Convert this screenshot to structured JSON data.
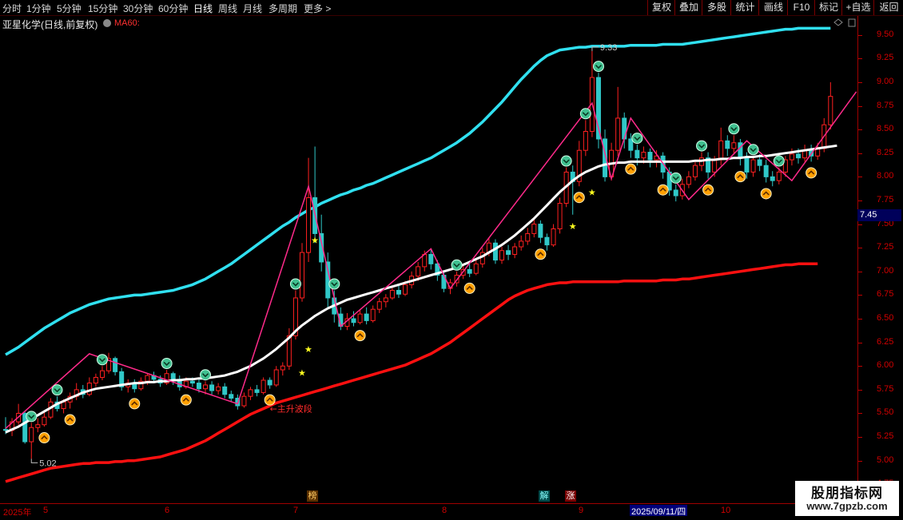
{
  "toolbar": {
    "periods": [
      "分时",
      "1分钟",
      "5分钟",
      "15分钟",
      "30分钟",
      "60分钟",
      "日线",
      "周线",
      "月线",
      "多周期",
      "更多 >"
    ],
    "active_period": "日线",
    "right_buttons": [
      "复权",
      "叠加",
      "多股",
      "统计",
      "画线",
      "F10",
      "标记",
      "+自选",
      "返回"
    ]
  },
  "header": {
    "stock_name": "亚星化学(日线,前复权)",
    "ma_label": "MA60:"
  },
  "price_axis": {
    "ticks": [
      "9.50",
      "9.25",
      "9.00",
      "8.75",
      "8.50",
      "8.25",
      "8.00",
      "7.75",
      "7.50",
      "7.25",
      "7.00",
      "6.75",
      "6.50",
      "6.25",
      "6.00",
      "5.75",
      "5.50",
      "5.25",
      "5.00",
      "4.75"
    ],
    "current_price": "7.45"
  },
  "date_axis": {
    "labels": [
      "2025年",
      "5",
      "6",
      "7",
      "8",
      "9",
      "10"
    ],
    "highlight": "2025/09/11/四"
  },
  "flags": [
    {
      "text": "榜",
      "color": "#ffcc66",
      "bg": "#5a3000"
    },
    {
      "text": "解",
      "color": "#88ffff",
      "bg": "#004a4a"
    },
    {
      "text": "涨",
      "color": "#ffffff",
      "bg": "#7a0000"
    }
  ],
  "annotations": {
    "high_label": "9.33",
    "low_label": "5.02",
    "wave_label": "←主升波段"
  },
  "colors": {
    "up": "#ff2020",
    "down": "#30c8c8",
    "upper_band": "#30e0f0",
    "lower_band": "#ff1010",
    "ma60": "#ffffff",
    "zigzag": "#ff2a8a",
    "sell_signal": "#40c090",
    "buy_signal": "#ffa000",
    "star": "#ffff20"
  },
  "watermark": {
    "title": "股朋指标网",
    "url": "www.7gpzb.com"
  },
  "chart_data": {
    "type": "candlestick",
    "ylim": [
      4.55,
      9.7
    ],
    "candles": [
      [
        5.33,
        5.32,
        5.46,
        5.28
      ],
      [
        5.32,
        5.41,
        5.45,
        5.26
      ],
      [
        5.41,
        5.5,
        5.6,
        5.38
      ],
      [
        5.5,
        5.2,
        5.52,
        5.18
      ],
      [
        5.2,
        5.35,
        5.4,
        5.02
      ],
      [
        5.35,
        5.38,
        5.45,
        5.3
      ],
      [
        5.38,
        5.46,
        5.52,
        5.36
      ],
      [
        5.46,
        5.62,
        5.66,
        5.44
      ],
      [
        5.62,
        5.55,
        5.68,
        5.52
      ],
      [
        5.55,
        5.62,
        5.65,
        5.5
      ],
      [
        5.62,
        5.68,
        5.72,
        5.55
      ],
      [
        5.68,
        5.75,
        5.82,
        5.64
      ],
      [
        5.75,
        5.7,
        5.8,
        5.66
      ],
      [
        5.7,
        5.82,
        5.88,
        5.68
      ],
      [
        5.82,
        5.88,
        5.92,
        5.78
      ],
      [
        5.88,
        5.95,
        6.0,
        5.85
      ],
      [
        5.95,
        6.08,
        6.14,
        5.92
      ],
      [
        6.08,
        5.94,
        6.1,
        5.9
      ],
      [
        5.94,
        5.78,
        5.98,
        5.74
      ],
      [
        5.78,
        5.82,
        5.86,
        5.72
      ],
      [
        5.82,
        5.76,
        5.86,
        5.72
      ],
      [
        5.76,
        5.84,
        5.88,
        5.74
      ],
      [
        5.84,
        5.9,
        5.92,
        5.8
      ],
      [
        5.9,
        5.86,
        5.94,
        5.82
      ],
      [
        5.86,
        5.82,
        5.9,
        5.78
      ],
      [
        5.82,
        5.92,
        5.96,
        5.8
      ],
      [
        5.92,
        5.86,
        5.94,
        5.8
      ],
      [
        5.86,
        5.78,
        5.9,
        5.74
      ],
      [
        5.78,
        5.84,
        5.88,
        5.76
      ],
      [
        5.84,
        5.82,
        5.88,
        5.78
      ],
      [
        5.82,
        5.76,
        5.86,
        5.72
      ],
      [
        5.76,
        5.8,
        5.84,
        5.7
      ],
      [
        5.8,
        5.74,
        5.84,
        5.7
      ],
      [
        5.74,
        5.78,
        5.82,
        5.7
      ],
      [
        5.78,
        5.7,
        5.82,
        5.66
      ],
      [
        5.7,
        5.66,
        5.74,
        5.62
      ],
      [
        5.66,
        5.58,
        5.7,
        5.54
      ],
      [
        5.58,
        5.68,
        5.72,
        5.56
      ],
      [
        5.68,
        5.75,
        5.78,
        5.64
      ],
      [
        5.75,
        5.72,
        5.8,
        5.68
      ],
      [
        5.72,
        5.85,
        5.88,
        5.7
      ],
      [
        5.85,
        5.8,
        5.88,
        5.76
      ],
      [
        5.8,
        5.96,
        6.0,
        5.78
      ],
      [
        5.96,
        6.0,
        6.04,
        5.9
      ],
      [
        6.0,
        6.32,
        6.4,
        5.96
      ],
      [
        6.32,
        6.72,
        6.8,
        6.28
      ],
      [
        6.72,
        7.2,
        7.3,
        6.68
      ],
      [
        7.2,
        7.78,
        8.2,
        7.1
      ],
      [
        7.78,
        7.4,
        8.32,
        7.3
      ],
      [
        7.4,
        7.1,
        7.6,
        7.0
      ],
      [
        7.1,
        6.72,
        7.2,
        6.6
      ],
      [
        6.72,
        6.55,
        6.8,
        6.46
      ],
      [
        6.55,
        6.42,
        6.62,
        6.38
      ],
      [
        6.42,
        6.5,
        6.56,
        6.38
      ],
      [
        6.5,
        6.46,
        6.58,
        6.42
      ],
      [
        6.46,
        6.55,
        6.6,
        6.44
      ],
      [
        6.55,
        6.48,
        6.62,
        6.44
      ],
      [
        6.48,
        6.6,
        6.64,
        6.46
      ],
      [
        6.6,
        6.68,
        6.72,
        6.56
      ],
      [
        6.68,
        6.72,
        6.76,
        6.62
      ],
      [
        6.72,
        6.8,
        6.84,
        6.7
      ],
      [
        6.8,
        6.76,
        6.86,
        6.72
      ],
      [
        6.76,
        6.86,
        6.9,
        6.74
      ],
      [
        6.86,
        6.95,
        7.0,
        6.82
      ],
      [
        6.95,
        7.05,
        7.1,
        6.9
      ],
      [
        7.05,
        7.18,
        7.22,
        7.0
      ],
      [
        7.18,
        7.08,
        7.24,
        7.02
      ],
      [
        7.08,
        6.96,
        7.12,
        6.9
      ],
      [
        6.96,
        6.82,
        7.0,
        6.78
      ],
      [
        6.82,
        6.88,
        6.92,
        6.76
      ],
      [
        6.88,
        6.96,
        7.0,
        6.84
      ],
      [
        6.96,
        7.02,
        7.06,
        6.92
      ],
      [
        7.02,
        6.98,
        7.08,
        6.94
      ],
      [
        6.98,
        7.08,
        7.12,
        6.96
      ],
      [
        7.08,
        7.2,
        7.25,
        7.04
      ],
      [
        7.2,
        7.3,
        7.36,
        7.16
      ],
      [
        7.3,
        7.12,
        7.34,
        7.08
      ],
      [
        7.12,
        7.22,
        7.26,
        7.08
      ],
      [
        7.22,
        7.18,
        7.28,
        7.12
      ],
      [
        7.18,
        7.26,
        7.3,
        7.14
      ],
      [
        7.26,
        7.32,
        7.38,
        7.22
      ],
      [
        7.32,
        7.4,
        7.46,
        7.28
      ],
      [
        7.4,
        7.5,
        7.56,
        7.36
      ],
      [
        7.5,
        7.36,
        7.54,
        7.3
      ],
      [
        7.36,
        7.28,
        7.4,
        7.22
      ],
      [
        7.28,
        7.45,
        7.5,
        7.26
      ],
      [
        7.45,
        7.72,
        7.78,
        7.4
      ],
      [
        7.72,
        8.05,
        8.1,
        7.68
      ],
      [
        8.05,
        7.95,
        8.12,
        7.6
      ],
      [
        7.95,
        8.28,
        8.38,
        7.9
      ],
      [
        8.28,
        8.48,
        8.6,
        8.22
      ],
      [
        8.48,
        9.05,
        9.33,
        8.42
      ],
      [
        9.05,
        8.4,
        9.1,
        8.3
      ],
      [
        8.4,
        8.0,
        8.5,
        7.95
      ],
      [
        8.0,
        8.28,
        8.36,
        7.96
      ],
      [
        8.28,
        8.62,
        8.95,
        8.22
      ],
      [
        8.62,
        8.4,
        8.68,
        8.3
      ],
      [
        8.4,
        8.28,
        8.46,
        8.2
      ],
      [
        8.28,
        8.2,
        8.34,
        8.12
      ],
      [
        8.2,
        8.26,
        8.32,
        8.14
      ],
      [
        8.26,
        8.18,
        8.3,
        8.1
      ],
      [
        8.18,
        8.22,
        8.28,
        8.1
      ],
      [
        8.22,
        8.05,
        8.26,
        7.98
      ],
      [
        8.05,
        7.86,
        8.1,
        7.8
      ],
      [
        7.86,
        7.8,
        7.92,
        7.74
      ],
      [
        7.8,
        7.92,
        7.98,
        7.76
      ],
      [
        7.92,
        8.0,
        8.06,
        7.88
      ],
      [
        8.0,
        8.12,
        8.18,
        7.96
      ],
      [
        8.12,
        8.2,
        8.26,
        8.06
      ],
      [
        8.2,
        8.05,
        8.26,
        7.98
      ],
      [
        8.05,
        8.18,
        8.22,
        8.0
      ],
      [
        8.18,
        8.38,
        8.52,
        8.12
      ],
      [
        8.38,
        8.3,
        8.44,
        8.22
      ],
      [
        8.3,
        8.36,
        8.44,
        8.24
      ],
      [
        8.36,
        8.2,
        8.4,
        8.12
      ],
      [
        8.2,
        8.05,
        8.26,
        7.98
      ],
      [
        8.05,
        8.18,
        8.22,
        8.0
      ],
      [
        8.18,
        8.12,
        8.24,
        8.06
      ],
      [
        8.12,
        8.0,
        8.18,
        7.94
      ],
      [
        8.0,
        7.96,
        8.06,
        7.9
      ],
      [
        7.96,
        8.05,
        8.1,
        7.92
      ],
      [
        8.05,
        8.18,
        8.22,
        8.0
      ],
      [
        8.18,
        8.24,
        8.3,
        8.12
      ],
      [
        8.24,
        8.2,
        8.3,
        8.14
      ],
      [
        8.2,
        8.28,
        8.34,
        8.16
      ],
      [
        8.28,
        8.22,
        8.34,
        8.16
      ],
      [
        8.22,
        8.3,
        8.36,
        8.18
      ],
      [
        8.3,
        8.55,
        8.62,
        8.26
      ],
      [
        8.55,
        8.85,
        9.0,
        8.5
      ]
    ],
    "zigzag": [
      [
        0,
        5.34
      ],
      [
        13,
        6.13
      ],
      [
        36,
        5.6
      ],
      [
        47,
        7.9
      ],
      [
        52,
        6.42
      ],
      [
        66,
        7.24
      ],
      [
        69,
        6.82
      ],
      [
        91,
        8.78
      ],
      [
        94,
        7.98
      ],
      [
        97,
        8.62
      ],
      [
        106,
        7.76
      ],
      [
        115,
        8.38
      ],
      [
        122,
        7.96
      ],
      [
        132,
        8.9
      ]
    ],
    "sell_signals": [
      4,
      8,
      15,
      25,
      31,
      45,
      51,
      70,
      87,
      90,
      92,
      98,
      104,
      108,
      113,
      116,
      120
    ],
    "buy_signals": [
      6,
      10,
      20,
      28,
      41,
      55,
      72,
      83,
      89,
      97,
      102,
      109,
      114,
      118,
      125
    ],
    "stars": [
      [
        48,
        7.33
      ],
      [
        47,
        6.18
      ],
      [
        46,
        5.93
      ],
      [
        88,
        7.48
      ],
      [
        91,
        7.84
      ]
    ],
    "ma60": [
      5.3,
      5.33,
      5.36,
      5.4,
      5.44,
      5.48,
      5.52,
      5.56,
      5.6,
      5.63,
      5.66,
      5.69,
      5.72,
      5.74,
      5.76,
      5.77,
      5.78,
      5.79,
      5.8,
      5.81,
      5.82,
      5.82,
      5.83,
      5.83,
      5.84,
      5.84,
      5.85,
      5.85,
      5.86,
      5.86,
      5.87,
      5.87,
      5.88,
      5.89,
      5.9,
      5.92,
      5.94,
      5.97,
      6.0,
      6.04,
      6.08,
      6.13,
      6.18,
      6.24,
      6.3,
      6.37,
      6.43,
      6.48,
      6.53,
      6.57,
      6.61,
      6.64,
      6.67,
      6.7,
      6.72,
      6.74,
      6.76,
      6.78,
      6.8,
      6.82,
      6.84,
      6.86,
      6.88,
      6.9,
      6.92,
      6.94,
      6.96,
      6.98,
      7.0,
      7.02,
      7.04,
      7.07,
      7.1,
      7.13,
      7.16,
      7.2,
      7.24,
      7.28,
      7.33,
      7.38,
      7.44,
      7.5,
      7.56,
      7.63,
      7.7,
      7.77,
      7.84,
      7.9,
      7.96,
      8.01,
      8.05,
      8.08,
      8.11,
      8.13,
      8.14,
      8.15,
      8.15,
      8.16,
      8.16,
      8.16,
      8.16,
      8.16,
      8.16,
      8.16,
      8.16,
      8.16,
      8.16,
      8.17,
      8.17,
      8.18,
      8.18,
      8.19,
      8.19,
      8.2,
      8.2,
      8.21,
      8.21,
      8.22,
      8.22,
      8.23,
      8.24,
      8.25,
      8.26,
      8.27,
      8.28,
      8.29,
      8.3,
      8.31,
      8.32,
      8.33
    ],
    "upper_band": [
      6.12,
      6.16,
      6.2,
      6.25,
      6.3,
      6.35,
      6.4,
      6.44,
      6.48,
      6.52,
      6.56,
      6.59,
      6.62,
      6.65,
      6.67,
      6.69,
      6.71,
      6.72,
      6.73,
      6.74,
      6.75,
      6.75,
      6.76,
      6.77,
      6.78,
      6.79,
      6.8,
      6.82,
      6.84,
      6.86,
      6.89,
      6.92,
      6.96,
      7.0,
      7.04,
      7.08,
      7.13,
      7.18,
      7.23,
      7.28,
      7.33,
      7.38,
      7.43,
      7.48,
      7.52,
      7.57,
      7.61,
      7.65,
      7.68,
      7.72,
      7.75,
      7.78,
      7.81,
      7.83,
      7.86,
      7.88,
      7.91,
      7.93,
      7.96,
      7.99,
      8.02,
      8.05,
      8.08,
      8.11,
      8.14,
      8.17,
      8.2,
      8.24,
      8.28,
      8.32,
      8.36,
      8.41,
      8.46,
      8.52,
      8.58,
      8.65,
      8.72,
      8.79,
      8.87,
      8.95,
      9.03,
      9.1,
      9.17,
      9.23,
      9.28,
      9.31,
      9.34,
      9.35,
      9.36,
      9.37,
      9.37,
      9.38,
      9.38,
      9.38,
      9.38,
      9.38,
      9.38,
      9.39,
      9.39,
      9.39,
      9.39,
      9.39,
      9.4,
      9.4,
      9.4,
      9.4,
      9.41,
      9.42,
      9.43,
      9.44,
      9.45,
      9.46,
      9.47,
      9.48,
      9.49,
      9.5,
      9.51,
      9.52,
      9.53,
      9.54,
      9.55,
      9.56,
      9.56,
      9.57,
      9.57,
      9.57,
      9.57,
      9.57,
      9.57
    ],
    "lower_band": [
      4.78,
      4.8,
      4.82,
      4.84,
      4.86,
      4.88,
      4.9,
      4.92,
      4.93,
      4.94,
      4.95,
      4.96,
      4.97,
      4.97,
      4.98,
      4.98,
      4.98,
      4.99,
      4.99,
      5.0,
      5.0,
      5.01,
      5.02,
      5.03,
      5.04,
      5.06,
      5.08,
      5.1,
      5.12,
      5.15,
      5.18,
      5.21,
      5.25,
      5.29,
      5.33,
      5.37,
      5.41,
      5.45,
      5.49,
      5.52,
      5.55,
      5.58,
      5.61,
      5.63,
      5.65,
      5.67,
      5.69,
      5.71,
      5.73,
      5.75,
      5.77,
      5.79,
      5.81,
      5.83,
      5.85,
      5.87,
      5.89,
      5.91,
      5.93,
      5.95,
      5.97,
      5.99,
      6.01,
      6.04,
      6.07,
      6.1,
      6.13,
      6.17,
      6.21,
      6.25,
      6.3,
      6.35,
      6.4,
      6.45,
      6.5,
      6.55,
      6.6,
      6.65,
      6.7,
      6.74,
      6.77,
      6.8,
      6.82,
      6.84,
      6.86,
      6.87,
      6.88,
      6.88,
      6.89,
      6.89,
      6.89,
      6.89,
      6.89,
      6.89,
      6.89,
      6.89,
      6.9,
      6.9,
      6.9,
      6.9,
      6.9,
      6.9,
      6.91,
      6.91,
      6.91,
      6.92,
      6.92,
      6.93,
      6.94,
      6.95,
      6.96,
      6.97,
      6.98,
      6.99,
      7.0,
      7.01,
      7.02,
      7.03,
      7.04,
      7.05,
      7.06,
      7.07,
      7.07,
      7.08,
      7.08,
      7.08,
      7.08
    ]
  }
}
